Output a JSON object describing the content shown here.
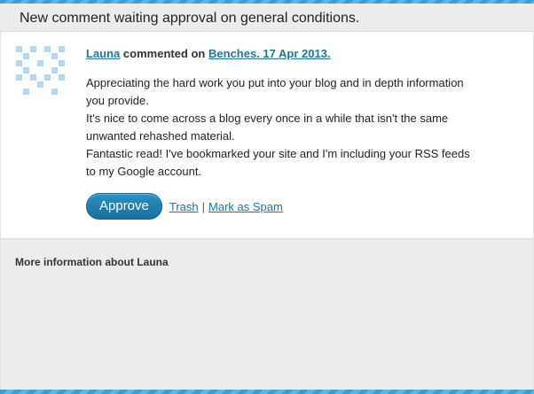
{
  "header": {
    "title": "New comment waiting approval on general conditions."
  },
  "comment": {
    "author": "Launa",
    "commented_on": "commented on",
    "post_title": "Benches. 17 Apr 2013.",
    "lines": [
      "Appreciating the hard work you put into your blog and in depth information",
      "you provide.",
      "It's nice to come across a blog every once in a while that isn't the same",
      "unwanted rehashed material.",
      "Fantastic read! I've bookmarked your site and I'm including your RSS feeds",
      "to my Google account."
    ]
  },
  "actions": {
    "approve_label": "Approve",
    "trash_label": "Trash",
    "separator": "|",
    "spam_label": "Mark as Spam"
  },
  "info": {
    "title": "More information about Launa"
  },
  "colors": {
    "accent": "#21759b",
    "button": "#1b6fa0",
    "panel_bg": "#ececec",
    "stripe": "#3a9fd0"
  },
  "icons": {
    "avatar": "identicon-avatar"
  }
}
